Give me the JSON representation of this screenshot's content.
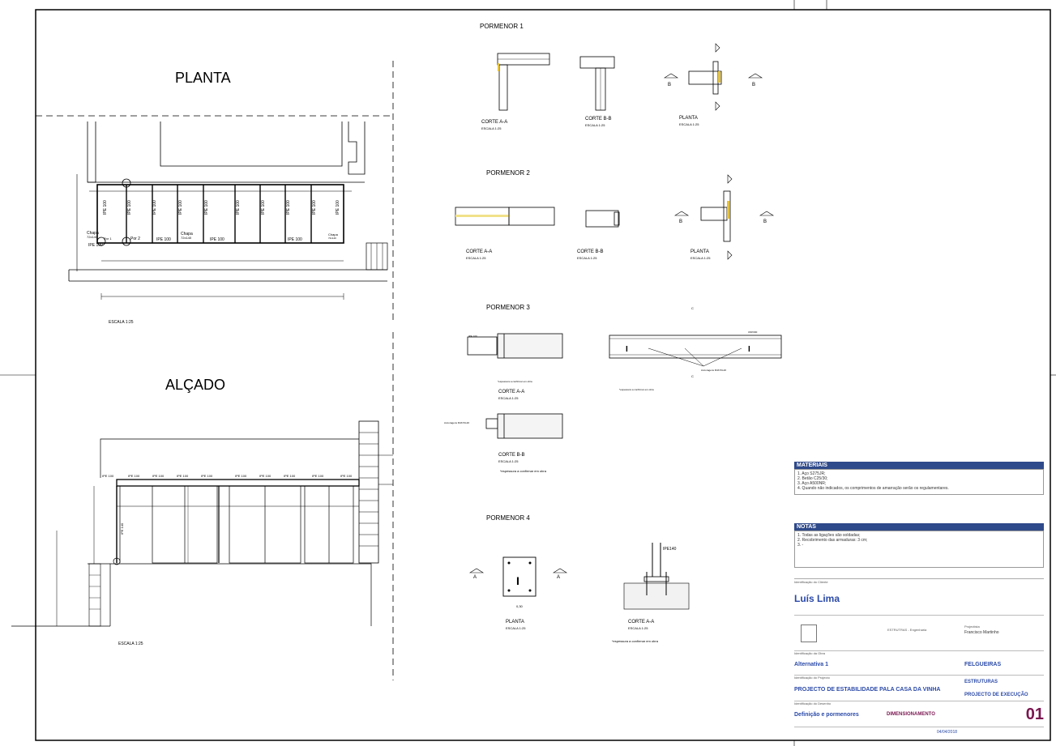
{
  "planta": {
    "title": "PLANTA",
    "scale": "ESCALA 1:25"
  },
  "alcado": {
    "title": "ALÇADO",
    "scale": "ESCALA 1:25"
  },
  "planta_labels": {
    "beams": [
      "IPE 100",
      "IPE 100",
      "IPE 100",
      "IPE 100",
      "IPE 100",
      "IPE 100",
      "IPE 100",
      "IPE 100",
      "IPE 100",
      "IPE 100"
    ],
    "chapa1": "Chapa",
    "chapa1_dim": "72x140",
    "chapa2": "Chapa",
    "chapa2_dim": "72x140",
    "chapa3": "Chapa",
    "chapa3_dim": "72x140",
    "ipe_bottom": [
      "IPE 100",
      "IPE 100",
      "IPE 100"
    ],
    "por": [
      "Por 1",
      "Por 2"
    ],
    "ipe_left": "IPE 100"
  },
  "alcado_labels": {
    "ipe_top": [
      "IPE 100",
      "IPE 100",
      "IPE 100",
      "IPE 100",
      "IPE 100",
      "IPE 100",
      "IPE 100",
      "IPE 100",
      "IPE 100",
      "IPE 100"
    ],
    "col": "IPE 140"
  },
  "p1": {
    "title": "PORMENOR 1",
    "cut_aa": "CORTE A-A",
    "cut_bb": "CORTE B-B",
    "plan": "PLANTA",
    "scale": "ESCALA 1:25",
    "a": "A",
    "b": "B"
  },
  "p2": {
    "title": "PORMENOR 2",
    "cut_aa": "CORTE A-A",
    "cut_bb": "CORTE B-B",
    "plan": "PLANTA",
    "scale": "ESCALA 1:25",
    "a": "A",
    "b": "B"
  },
  "p3": {
    "title": "PORMENOR 3",
    "cut_aa": "CORTE A-A",
    "cut_bb": "CORTE B-B",
    "scale": "ESCALA 1:25",
    "note": "*espessura a confirmar em obra",
    "unp": "UNP200",
    "ipe": "IPE 100",
    "anch": "Ancoragens M16 5/L20",
    "c": "C"
  },
  "p4": {
    "title": "PORMENOR 4",
    "plan": "PLANTA",
    "cut_aa": "CORTE A-A",
    "scale": "ESCALA 1:25",
    "note": "*espessura a confirmar em obra",
    "ipe": "IPE140",
    "a": "A",
    "dim": "0,30"
  },
  "titleblock": {
    "materiais_hdr": "MATERIAIS",
    "materiais": [
      "1. Aço S275JR;",
      "2. Betão C25/30;",
      "3. Aço A500NR;",
      "4. Quando não indicados, os comprimentos de amarração serão os regulamentares."
    ],
    "notas_hdr": "NOTAS",
    "notas": [
      "1. Todas as ligações são soldadas;",
      "2. Recobrimento das armaduras: 3 cm;",
      "3. -"
    ],
    "client_lbl": "Identificação do Cliente",
    "client": "Luís Lima",
    "company": "ESTRUTRAS - Engenharia",
    "engineer_lbl": "Projectista",
    "engineer": "Francisco Martinho",
    "work_lbl": "Identificação da Obra",
    "work": "Alternativa 1",
    "place": "FELGUEIRAS",
    "project_lbl": "Identificação do Projecto",
    "project": "PROJECTO DE ESTABILIDADE PALA CASA DA VINHA",
    "specialty": "ESTRUTURAS",
    "phase": "PROJECTO DE EXECUÇÃO",
    "drawing_lbl": "Identificação do Desenho",
    "drawing": "Definição e pormenores",
    "type": "DIMENSIONAMENTO",
    "number": "01",
    "date": "04/04/2018"
  }
}
